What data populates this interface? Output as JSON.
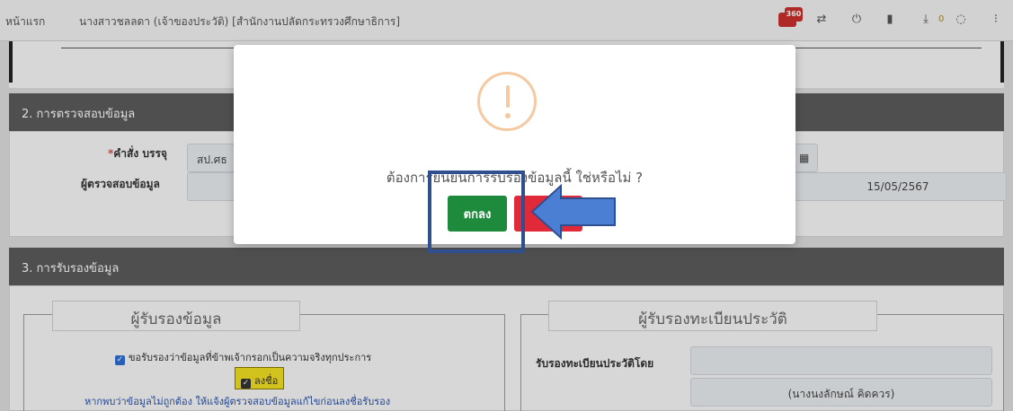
{
  "nav": {
    "home": "หน้าแรก",
    "user": "นางสาวชลลดา (เจ้าของประวัติ) [สำนักงานปลัดกระทรวงศึกษาธิการ]",
    "badge": "360",
    "download_count": "0"
  },
  "section2": {
    "title": "2. การตรวจสอบข้อมูล",
    "order_label_required": "*",
    "order_label": "คำสั่ง บรรจุ",
    "order_value": "สป.ศธ",
    "checker_label": "ผู้ตรวจสอบข้อมูล",
    "date_value": "15/05/2567"
  },
  "section3": {
    "title": "3. การรับรองข้อมูล",
    "left_legend": "ผู้รับรองข้อมูล",
    "certify_text": "ขอรับรองว่าข้อมูลที่ข้าพเจ้ากรอกเป็นความจริงทุกประการ",
    "sign_button": "ลงชื่อ",
    "warning_text": "หากพบว่าข้อมูลไม่ถูกต้อง ให้แจ้งผู้ตรวจสอบข้อมูลแก้ไขก่อนลงชื่อรับรอง",
    "right_legend": "ผู้รับรองทะเบียนประวัติ",
    "certified_by_label": "รับรองทะเบียนประวัติโดย",
    "certifier_name": "(นางนงลักษณ์ คิดควร)"
  },
  "modal": {
    "message": "ต้องการยืนยันการรับรองข้อมูลนี้ ใช่หรือไม่ ?",
    "confirm_label": "ตกลง",
    "cancel_label": ""
  },
  "icons": {
    "warning": "warning-icon",
    "arrow": "pointer-arrow"
  },
  "colors": {
    "confirm": "#1e8b3c",
    "cancel": "#e02a3a",
    "warning": "#f5c9a1",
    "annotation": "#2f4f8f",
    "arrow": "#4a7fd4"
  }
}
